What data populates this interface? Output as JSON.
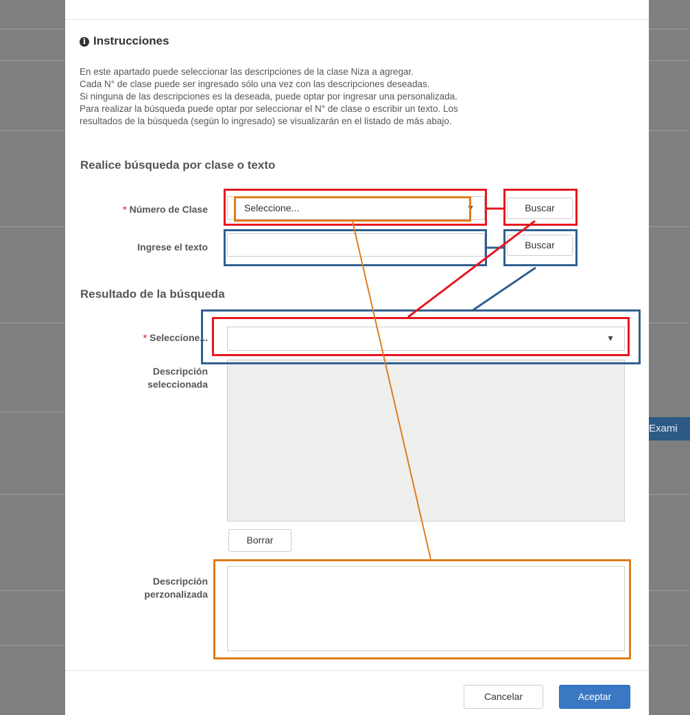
{
  "background": {
    "side_button_label": "Exami"
  },
  "modal": {
    "title": "Instrucciones",
    "instructions": [
      "En este apartado puede seleccionar las descripciones de la clase Niza a agregar.",
      "Cada N° de clase puede ser ingresado sólo una vez con las descripciones deseadas.",
      "Si ninguna de las descripciones es la deseada, puede optar por ingresar una personalizada.",
      "Para realizar la búsqueda puede optar por seleccionar el N° de clase o escribir un texto. Los",
      "resultados de la búsqueda (según lo ingresado) se visualizarán en el listado de más abajo."
    ],
    "search_section": {
      "heading": "Realice búsqueda por clase o texto",
      "required_mark": "*",
      "class_label": "Número de Clase",
      "class_select_value": "Seleccione...",
      "text_label": "Ingrese el texto",
      "text_value": "",
      "search_button": "Buscar"
    },
    "result_section": {
      "heading": "Resultado de la búsqueda",
      "select_label": "Seleccione...",
      "select_value": "",
      "selected_desc_label_1": "Descripción",
      "selected_desc_label_2": "seleccionada",
      "clear_button": "Borrar",
      "custom_desc_label_1": "Descripción",
      "custom_desc_label_2": "perzonalizada"
    },
    "footer": {
      "cancel": "Cancelar",
      "accept": "Aceptar"
    }
  },
  "annotation_colors": {
    "red": "#e8141e",
    "blue": "#2f5f8f",
    "orange": "#e07b1a"
  }
}
